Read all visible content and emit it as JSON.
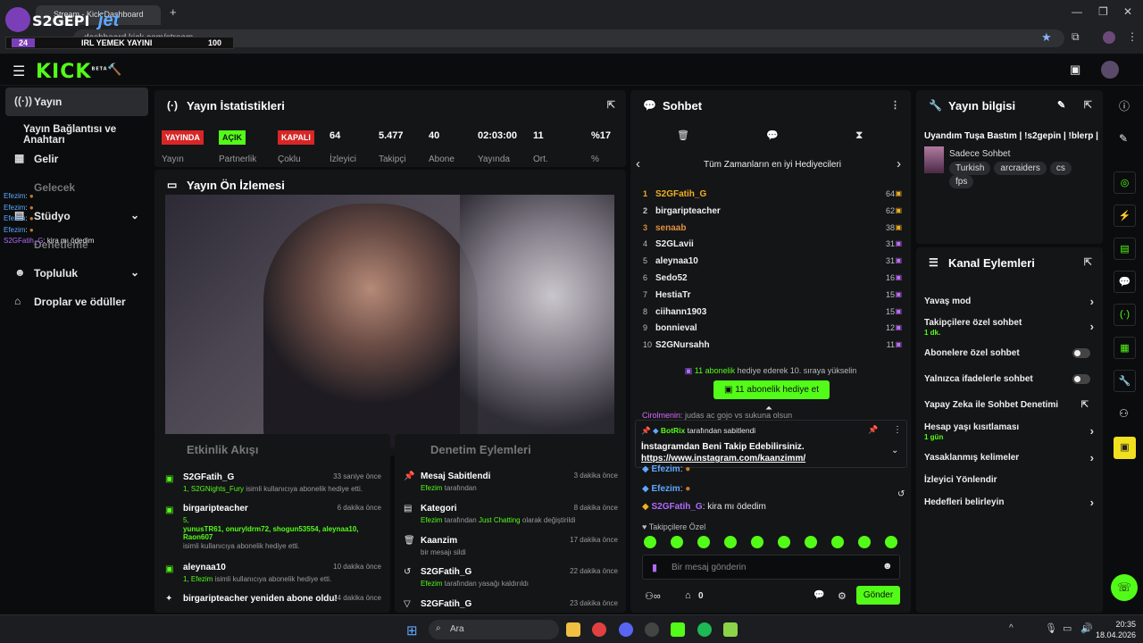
{
  "browser": {
    "tab_title": "Stream - Kick Dashboard",
    "url": "dashboard.kick.com/stream"
  },
  "overlay": {
    "logo": "S2GEPI",
    "brand": "jet",
    "count_left": "24",
    "title": "IRL YEMEK YAYINI",
    "count_right": "100"
  },
  "header": {
    "logo": "KICK",
    "logo_badge": "BETA"
  },
  "sidebar": {
    "items": [
      {
        "label": "Yayın",
        "icon": "broadcast-icon"
      },
      {
        "label": "Yayın Bağlantısı ve Anahtarı",
        "icon": ""
      },
      {
        "label": "Gelir",
        "icon": "chart-icon"
      },
      {
        "label": "Stüdyo",
        "icon": "studio-icon"
      },
      {
        "label": "Topluluk",
        "icon": "community-icon"
      },
      {
        "label": "Droplar ve ödüller",
        "icon": "gift-icon"
      }
    ],
    "overlay_chat": [
      {
        "user": "Efezim",
        "text": ":"
      },
      {
        "user": "Efezim",
        "text": ":"
      },
      {
        "user": "Efezim",
        "text": ":"
      },
      {
        "user": "Efezim",
        "text": ":"
      },
      {
        "user": "S2GFatih_G",
        "text": ": kira mı ödedim"
      }
    ],
    "overlay_partial_1": "Gelecek",
    "overlay_partial_2": "Denetleme"
  },
  "stats": {
    "title": "Yayın İstatistikleri",
    "columns": [
      {
        "value": "YAYINDA",
        "label": "Yayın"
      },
      {
        "value": "AÇIK",
        "label": "Partnerlik"
      },
      {
        "value": "KAPALI",
        "label": "Çoklu"
      },
      {
        "value": "64",
        "label": "İzleyici"
      },
      {
        "value": "5.477",
        "label": "Takipçi"
      },
      {
        "value": "40",
        "label": "Abone"
      },
      {
        "value": "02:03:00",
        "label": "Yayında"
      },
      {
        "value": "11",
        "label": "Ort."
      },
      {
        "value": "%17",
        "label": "%"
      }
    ]
  },
  "preview": {
    "title": "Yayın Ön İzlemesi"
  },
  "activity": {
    "title": "Etkinlik Akışı",
    "items": [
      {
        "name": "S2GFatih_G",
        "time": "33 saniye önce",
        "line1_hl": "1, S2GNights_Fury",
        "line1_rest": " isimli kullanıcıya abonelik hediye etti.",
        "line2": ""
      },
      {
        "name": "birgaripteacher",
        "time": "6 dakika önce",
        "line1_hl": "5,",
        "line1_rest": "",
        "line2": "yunusTR61, onuryldrm72, shogun53554, aleynaa10, Raon607",
        "line3": "isimli kullanıcıya abonelik hediye etti."
      },
      {
        "name": "aleynaa10",
        "time": "10 dakika önce",
        "line1_hl": "1, Efezim",
        "line1_rest": " isimli kullanıcıya abonelik hediye etti.",
        "line2": ""
      },
      {
        "name": "birgaripteacher yeniden abone oldu!",
        "time": "14 dakika önce",
        "line1_hl": "",
        "line1_rest": "",
        "line2": ""
      }
    ]
  },
  "mod_actions": {
    "title": "Denetim Eylemleri",
    "items": [
      {
        "title": "Mesaj Sabitlendi",
        "time": "3 dakika önce",
        "hl": "Efezim",
        "rest": " tarafından",
        "hl2": "",
        "rest2": ""
      },
      {
        "title": "Kategori",
        "time": "8 dakika önce",
        "hl": "Efezim",
        "rest": " tarafından ",
        "hl2": "Just Chatting",
        "rest2": " olarak değiştirildi"
      },
      {
        "title": "Kaanzim",
        "time": "17 dakika önce",
        "hl": "",
        "rest": "bir mesajı sildi",
        "hl2": "",
        "rest2": ""
      },
      {
        "title": "S2GFatih_G",
        "time": "22 dakika önce",
        "hl": "Efezim",
        "rest": " tarafından yasağı kaldırıldı",
        "hl2": "",
        "rest2": ""
      },
      {
        "title": "S2GFatih_G",
        "time": "23 dakika önce",
        "hl": "",
        "rest": "",
        "hl2": "",
        "rest2": ""
      }
    ]
  },
  "chat": {
    "title": "Sohbet",
    "leaderboard_title": "Tüm Zamanların en iyi Hediyecileri",
    "gifters": [
      {
        "rank": "1",
        "name": "S2GFatih_G",
        "count": "64"
      },
      {
        "rank": "2",
        "name": "birgaripteacher",
        "count": "62"
      },
      {
        "rank": "3",
        "name": "senaab",
        "count": "38"
      },
      {
        "rank": "4",
        "name": "S2GLavii",
        "count": "31"
      },
      {
        "rank": "5",
        "name": "aleynaa10",
        "count": "31"
      },
      {
        "rank": "6",
        "name": "Sedo52",
        "count": "16"
      },
      {
        "rank": "7",
        "name": "HestiaTr",
        "count": "15"
      },
      {
        "rank": "8",
        "name": "ciihann1903",
        "count": "15"
      },
      {
        "rank": "9",
        "name": "bonnieval",
        "count": "12"
      },
      {
        "rank": "10",
        "name": "S2GNursahh",
        "count": "11"
      }
    ],
    "promo_hl": "11 abonelik",
    "promo_rest": " hediye ederek 10. sıraya yükselin",
    "gift_button": "11 abonelik hediye et",
    "pinned_by_user": "BotRix",
    "pinned_by_rest": " tarafından sabitlendi",
    "pinned_text": "İnstagramdan Beni Takip Edebilirsiniz.",
    "pinned_link": "https://www.instagram.com/kaanzimm/",
    "partial_line_user": "Cirolmenin",
    "partial_line": ": judas ac gojo vs sukuna olsun",
    "messages": [
      {
        "user": "Efezim",
        "text": ":"
      },
      {
        "user": "Efezim",
        "text": ":"
      },
      {
        "user": "S2GFatih_G",
        "text": ": kira mı ödedim"
      }
    ],
    "followers_only": "Takipçilere Özel",
    "input_placeholder": "Bir mesaj gönderin",
    "points": "0",
    "send_button": "Gönder"
  },
  "stream_info": {
    "title": "Yayın bilgisi",
    "stream_title": "Uyandım Tuşa Bastım | !s2gepin | !blerp |",
    "category": "Sadece Sohbet",
    "tags": [
      "Turkish",
      "arcraiders",
      "cs",
      "fps"
    ]
  },
  "channel_actions": {
    "title": "Kanal Eylemleri",
    "items": [
      {
        "label": "Yavaş mod",
        "sub": "",
        "control": "chevron"
      },
      {
        "label": "Takipçilere özel sohbet",
        "sub": "1 dk.",
        "control": "chevron"
      },
      {
        "label": "Abonelere özel sohbet",
        "sub": "",
        "control": "toggle"
      },
      {
        "label": "Yalnızca ifadelerle sohbet",
        "sub": "",
        "control": "toggle"
      },
      {
        "label": "Yapay Zeka ile Sohbet Denetimi",
        "sub": "",
        "control": "external"
      },
      {
        "label": "Hesap yaşı kısıtlaması",
        "sub": "1 gün",
        "control": "chevron"
      },
      {
        "label": "Yasaklanmış kelimeler",
        "sub": "",
        "control": "chevron"
      },
      {
        "label": "İzleyici Yönlendir",
        "sub": "",
        "control": "none"
      },
      {
        "label": "Hedefleri belirleyin",
        "sub": "",
        "control": "chevron"
      }
    ]
  },
  "taskbar": {
    "search": "Ara",
    "time": "20:35",
    "date": "18.04.2026"
  },
  "colors": {
    "accent": "#53fc18",
    "live": "#d72626",
    "panel": "#141517",
    "bg": "#0b0c0d"
  }
}
